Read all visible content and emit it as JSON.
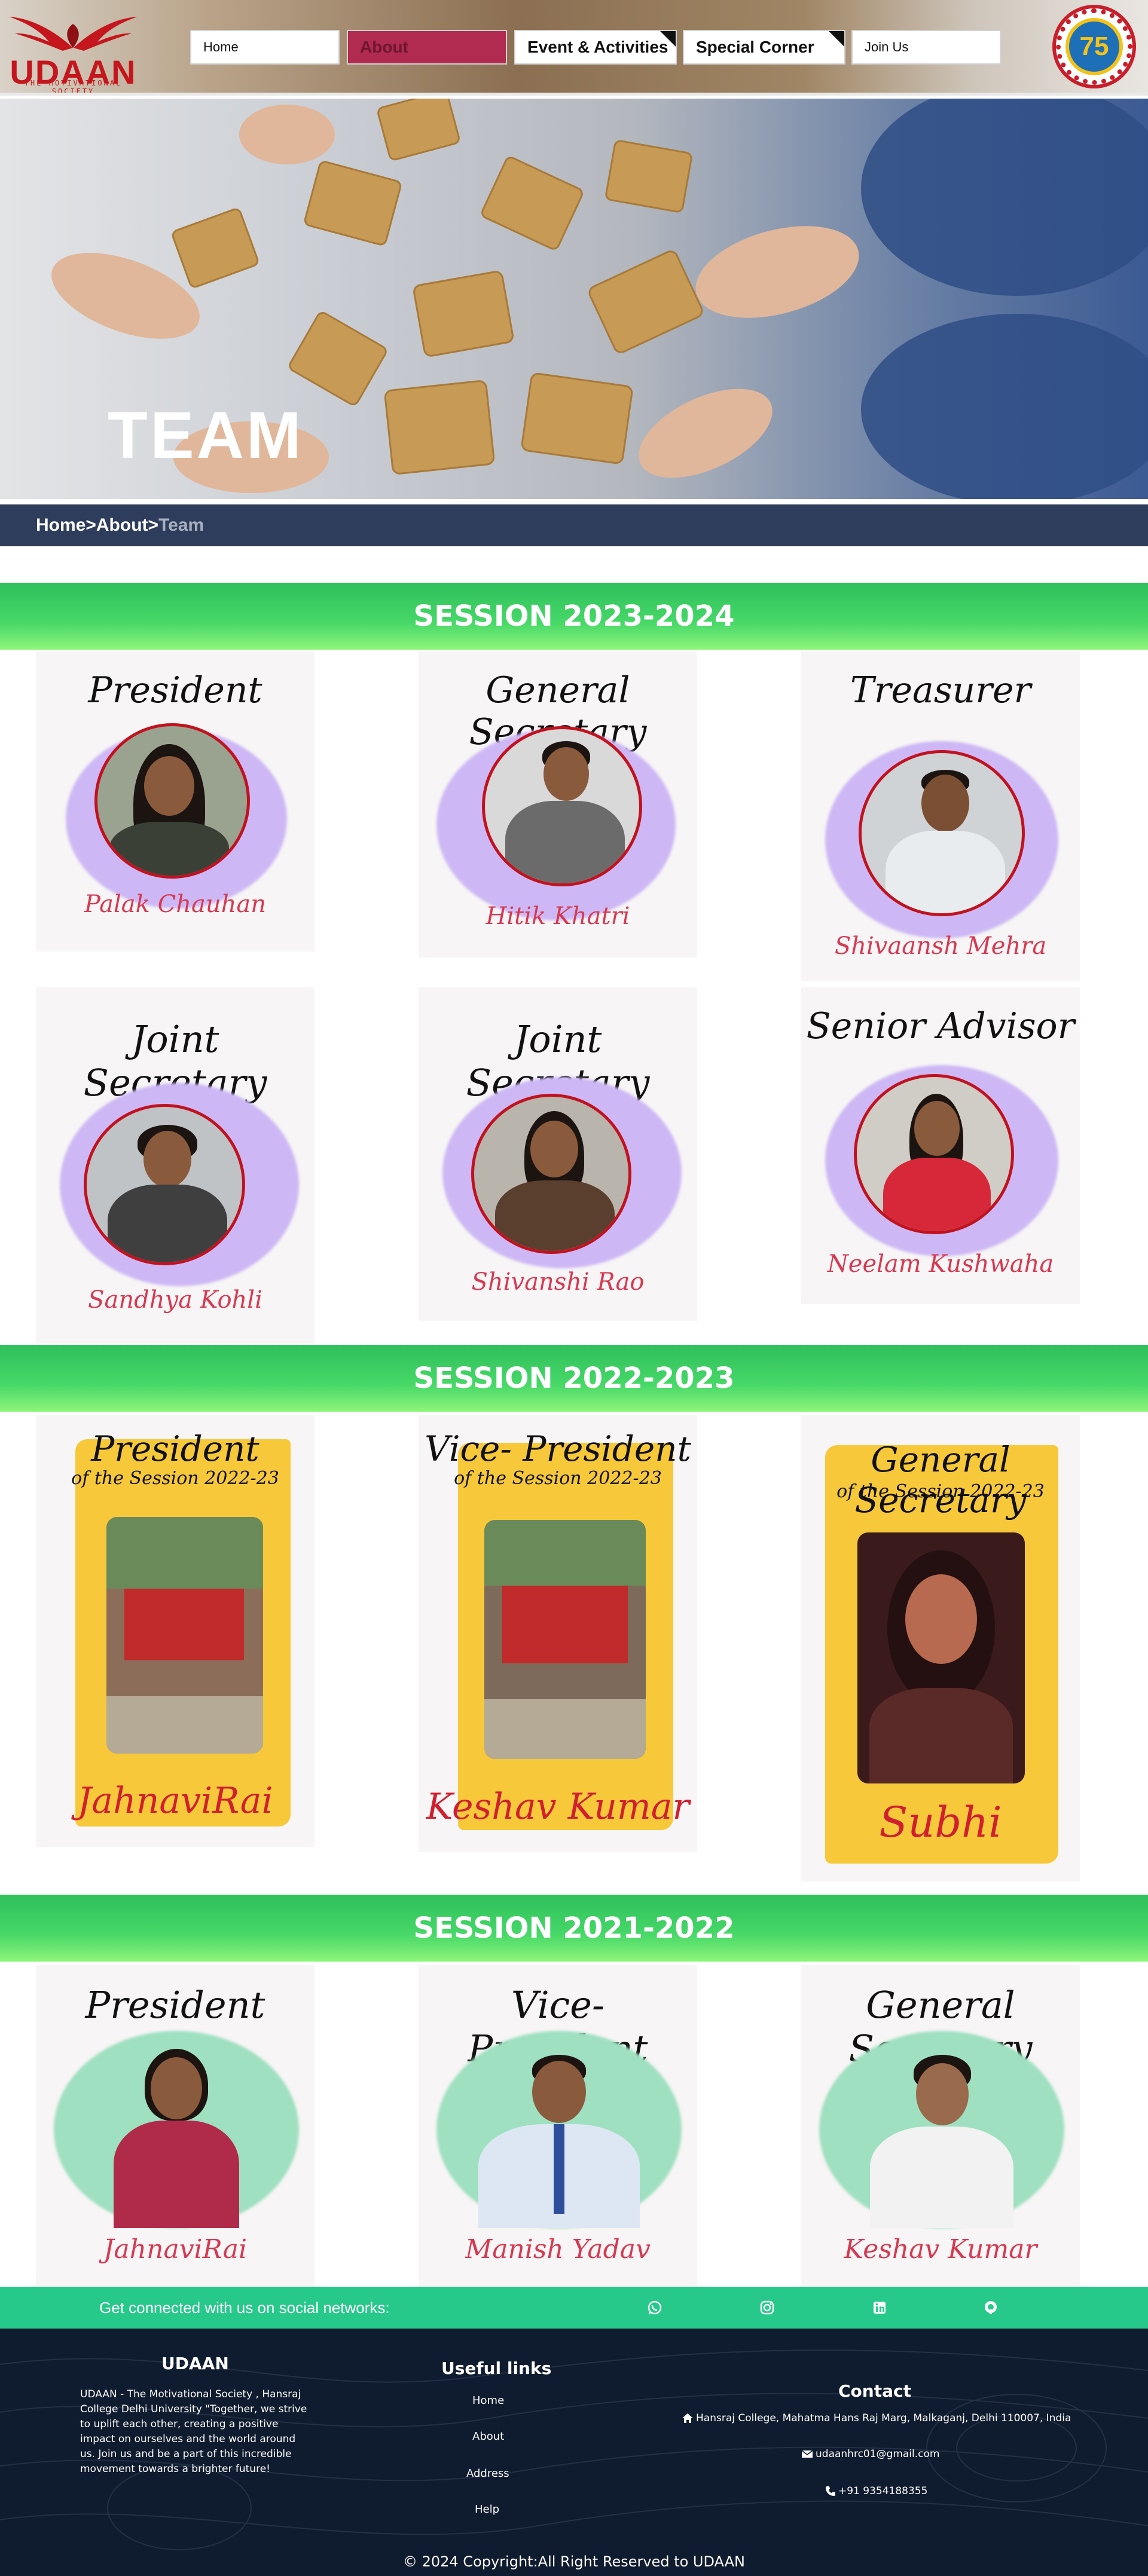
{
  "brand": {
    "name": "UDAAN",
    "tagline": "THE MOTIVATIONAL SOCIETY",
    "badge": "75"
  },
  "nav": {
    "home": "Home",
    "about": "About",
    "events": "Event & Activities",
    "special": "Special Corner",
    "join": "Join Us"
  },
  "hero": {
    "title": "TEAM"
  },
  "breadcrumb": {
    "home": "Home",
    "sep1": ">",
    "about": "About",
    "sep2": ">",
    "current": "Team"
  },
  "sessions": [
    {
      "title": "SESSION 2023-2024",
      "members": [
        {
          "role": "President",
          "name": "Palak Chauhan"
        },
        {
          "role": "General Secretary",
          "name": "Hitik Khatri"
        },
        {
          "role": "Treasurer",
          "name": "Shivaansh Mehra"
        },
        {
          "role": "Joint Secretary",
          "name": "Sandhya Kohli"
        },
        {
          "role": "Joint Secretary",
          "name": "Shivanshi Rao"
        },
        {
          "role": "Senior Advisor",
          "name": "Neelam Kushwaha"
        }
      ]
    },
    {
      "title": "SESSION 2022-2023",
      "members": [
        {
          "role": "President",
          "subrole": "of the Session 2022-23",
          "name": "JahnaviRai"
        },
        {
          "role": "Vice- President",
          "subrole": "of the Session 2022-23",
          "name": "Keshav Kumar"
        },
        {
          "role": "General Secretary",
          "subrole": "of the Session 2022-23",
          "name": "Subhi"
        }
      ]
    },
    {
      "title": "SESSION 2021-2022",
      "members": [
        {
          "role": "President",
          "name": "JahnaviRai"
        },
        {
          "role": "Vice- President",
          "name": "Manish Yadav"
        },
        {
          "role": "General Secretary",
          "name": "Keshav Kumar"
        }
      ]
    }
  ],
  "social": {
    "text": "Get connected with us on social networks:",
    "icons": [
      "whatsapp-icon",
      "instagram-icon",
      "linkedin-icon",
      "github-icon"
    ]
  },
  "footer": {
    "about_heading": "UDAAN",
    "about_text": "UDAAN - The Motivational Society , Hansraj College Delhi University \"Together, we strive to uplift each other, creating a positive impact on ourselves and the world around us. Join us and be a part of this incredible movement towards a brighter future!",
    "links_heading": "Useful links",
    "links": [
      "Home",
      "About",
      "Address",
      "Help"
    ],
    "contact_heading": "Contact",
    "address": "Hansraj College, Mahatma Hans Raj Marg, Malkaganj, Delhi 110007, India",
    "email": "udaanhrc01@gmail.com",
    "phone": "+91 9354188355",
    "copyright": "© 2024 Copyright:All Right Reserved to UDAAN"
  },
  "colors": {
    "nav_active": "#b12a4f",
    "breadcrumb_bg": "#2e3d5c",
    "session_green": "#47d868",
    "social_bar": "#26c98a",
    "footer_bg": "#0f1b2e",
    "name_red": "#d63a52",
    "frame_red": "#c1121f"
  }
}
